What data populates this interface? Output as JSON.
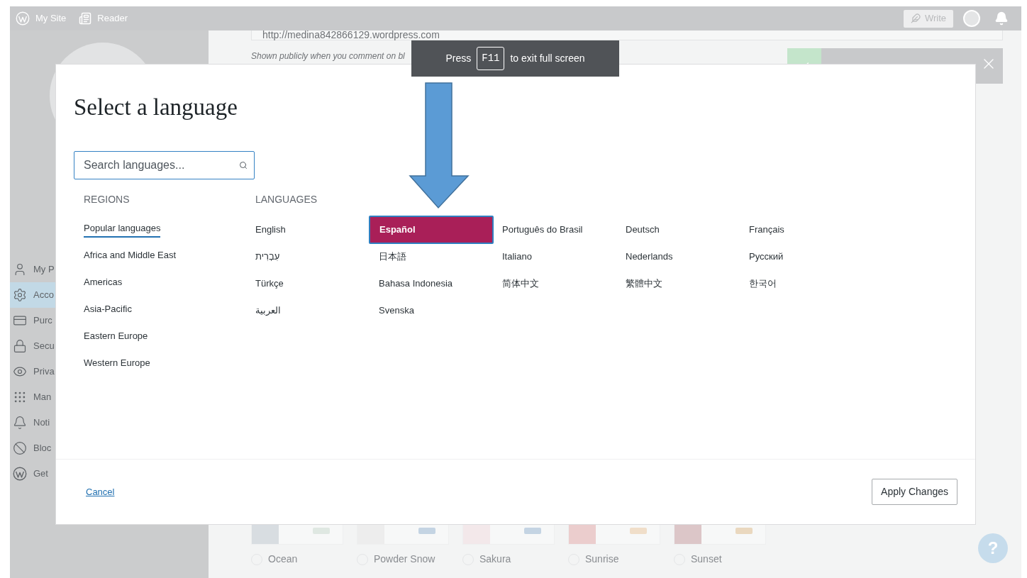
{
  "top_bar": {
    "items": [
      {
        "label": "My Site"
      },
      {
        "label": "Reader"
      }
    ],
    "write_button": "Write"
  },
  "sidebar": {
    "items": [
      {
        "label": "My P",
        "selected": false
      },
      {
        "label": "Acco",
        "selected": true
      },
      {
        "label": "Purc",
        "selected": false
      },
      {
        "label": "Secu",
        "selected": false
      },
      {
        "label": "Priva",
        "selected": false
      },
      {
        "label": "Man",
        "selected": false
      },
      {
        "label": "Noti",
        "selected": false
      },
      {
        "label": "Bloc",
        "selected": false
      },
      {
        "label": "Get",
        "selected": false
      }
    ]
  },
  "profile": {
    "url_field": {
      "value": "http://medina842866129.wordpress.com"
    },
    "url_hint": "Shown publicly when you comment on bl",
    "color_schemes": [
      {
        "name": "Ocean",
        "selected": false,
        "color": "#d8dde1",
        "accent": {
          "color": "#dfe8e2"
        }
      },
      {
        "name": "Powder Snow",
        "selected": false,
        "color": "#ededed",
        "accent": {
          "color": "#c4d4e3"
        }
      },
      {
        "name": "Sakura",
        "selected": false,
        "color": "#f3e8ea",
        "accent": {
          "color": "#c4d4e3"
        }
      },
      {
        "name": "Sunrise",
        "selected": false,
        "color": "#ebcdcd",
        "accent": {
          "color": "#f0dec9"
        }
      },
      {
        "name": "Sunset",
        "selected": false,
        "color": "#dcc6c8",
        "accent": {
          "color": "#ead8bf"
        }
      }
    ]
  },
  "fullscreen_toast": {
    "before": "Press",
    "key": "F11",
    "after": "to exit full screen"
  },
  "modal": {
    "title": "Select a language",
    "search": {
      "placeholder": "Search languages..."
    },
    "regions_heading": "REGIONS",
    "languages_heading": "LANGUAGES",
    "regions": [
      {
        "label": "Popular languages",
        "selected": true
      },
      {
        "label": "Africa and Middle East",
        "selected": false
      },
      {
        "label": "Americas",
        "selected": false
      },
      {
        "label": "Asia-Pacific",
        "selected": false
      },
      {
        "label": "Eastern Europe",
        "selected": false
      },
      {
        "label": "Western Europe",
        "selected": false
      }
    ],
    "languages": [
      {
        "label": "English",
        "selected": false
      },
      {
        "label": "Español",
        "selected": true
      },
      {
        "label": "Português do Brasil",
        "selected": false
      },
      {
        "label": "Deutsch",
        "selected": false
      },
      {
        "label": "Français",
        "selected": false
      },
      {
        "label": "עִבְרִית",
        "selected": false
      },
      {
        "label": "日本語",
        "selected": false
      },
      {
        "label": "Italiano",
        "selected": false
      },
      {
        "label": "Nederlands",
        "selected": false
      },
      {
        "label": "Русский",
        "selected": false
      },
      {
        "label": "Türkçe",
        "selected": false
      },
      {
        "label": "Bahasa Indonesia",
        "selected": false
      },
      {
        "label": "简体中文",
        "selected": false
      },
      {
        "label": "繁體中文",
        "selected": false
      },
      {
        "label": "한국어",
        "selected": false
      },
      {
        "label": "العربية",
        "selected": false
      },
      {
        "label": "Svenska",
        "selected": false
      }
    ],
    "cancel": "Cancel",
    "apply": "Apply Changes"
  },
  "help_button": "?"
}
